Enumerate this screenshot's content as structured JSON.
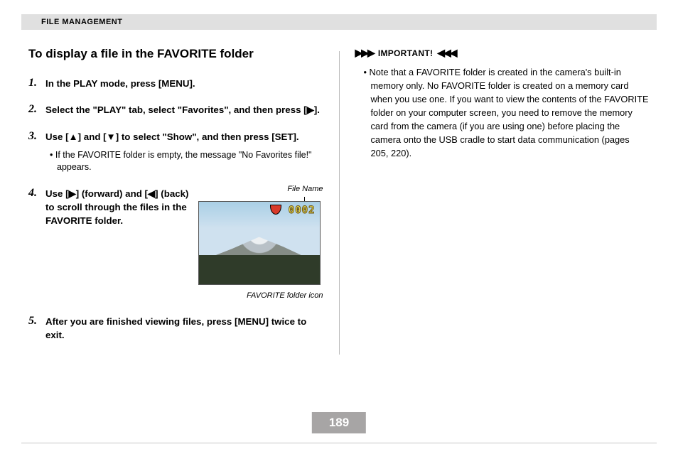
{
  "header": {
    "section": "FILE MANAGEMENT"
  },
  "left": {
    "title": "To display a file in the FAVORITE folder",
    "steps": {
      "s1": "In the PLAY mode, press [MENU].",
      "s2": "Select the \"PLAY\" tab, select \"Favorites\", and then press [▶].",
      "s3": "Use [▲] and [▼] to select \"Show\", and then press [SET].",
      "s3_note": "If the FAVORITE folder is empty, the message \"No Favorites file!\" appears.",
      "s4": "Use [▶] (forward) and [◀] (back) to scroll through the files in the FAVORITE folder.",
      "s5": "After you are finished viewing files, press [MENU] twice to exit."
    },
    "figure": {
      "file_name_label": "File Name",
      "file_number": "0002",
      "favorite_caption": "FAVORITE folder icon"
    }
  },
  "right": {
    "important_markers": {
      "fwd": "▶▶▶",
      "label": "IMPORTANT!",
      "back": "◀◀◀"
    },
    "note": "Note that a FAVORITE folder is created in the camera's built-in memory only. No FAVORITE folder is created on a memory card when you use one. If you want to view the contents of the FAVORITE folder on your computer screen, you need to remove the memory card from the camera (if you are using one) before placing the camera onto the USB cradle to start data communication (pages 205, 220)."
  },
  "page_number": "189"
}
